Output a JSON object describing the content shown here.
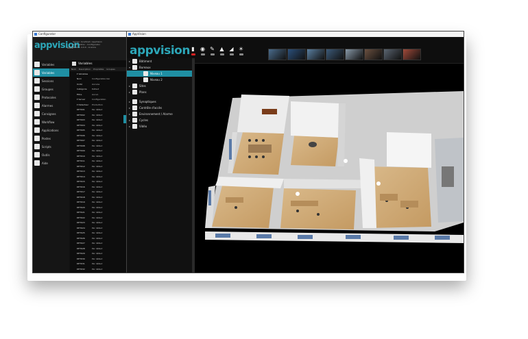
{
  "window1": {
    "title": "Configurator",
    "logo": "appvision",
    "logo_sub": "v4.0",
    "info_lines": [
      "Server: localhost / AppVision",
      "User: admin - Configurator",
      "Version 4.0.0 - Licence"
    ],
    "nav": [
      {
        "label": "Variables",
        "icon": "variables-icon",
        "active": false
      },
      {
        "label": "Variables",
        "icon": "variables-icon",
        "active": true
      },
      {
        "label": "Sessions",
        "icon": "sessions-icon",
        "active": false
      },
      {
        "label": "Groupes",
        "icon": "groups-icon",
        "active": false
      },
      {
        "label": "Protocoles",
        "icon": "protocols-icon",
        "active": false
      },
      {
        "label": "Alarmes",
        "icon": "alarms-icon",
        "active": false
      },
      {
        "label": "Consignes",
        "icon": "instructions-icon",
        "active": false
      },
      {
        "label": "Workflow",
        "icon": "workflow-icon",
        "active": false
      },
      {
        "label": "Applications",
        "icon": "applications-icon",
        "active": false
      },
      {
        "label": "Postes",
        "icon": "stations-icon",
        "active": false
      },
      {
        "label": "Scripts",
        "icon": "scripts-icon",
        "active": false
      },
      {
        "label": "Outils",
        "icon": "tools-icon",
        "active": false
      },
      {
        "label": "Aide",
        "icon": "help-icon",
        "active": false
      }
    ],
    "panel_title": "Variables",
    "tabs": [
      "Nom",
      "Description",
      "Propriétés",
      "Groupes"
    ],
    "rows": [
      {
        "c1": "▾ Variables",
        "c2": ""
      },
      {
        "c1": "Nom",
        "c2": "Configuration.Var"
      },
      {
        "c1": "Unité",
        "c2": "Aucune"
      },
      {
        "c1": "Catégorie",
        "c2": "Défaut"
      },
      {
        "c1": "Filtre",
        "c2": "Aucun"
      },
      {
        "c1": "▾ Server",
        "c2": "Configuration"
      },
      {
        "c1": "▾ Detecteur",
        "c2": "Production"
      },
      {
        "c1": "DET001",
        "c2": "Par défaut"
      },
      {
        "c1": "DET002",
        "c2": "Par défaut"
      },
      {
        "c1": "DET003",
        "c2": "Par défaut"
      },
      {
        "c1": "DET004",
        "c2": "Par défaut"
      },
      {
        "c1": "DET005",
        "c2": "Par défaut"
      },
      {
        "c1": "DET006",
        "c2": "Par défaut"
      },
      {
        "c1": "DET007",
        "c2": "Par défaut"
      },
      {
        "c1": "DET008",
        "c2": "Par défaut"
      },
      {
        "c1": "DET009",
        "c2": "Par défaut"
      },
      {
        "c1": "DET010",
        "c2": "Par défaut"
      },
      {
        "c1": "DET011",
        "c2": "Par défaut"
      },
      {
        "c1": "DET012",
        "c2": "Par défaut"
      },
      {
        "c1": "DET013",
        "c2": "Par défaut"
      },
      {
        "c1": "DET014",
        "c2": "Par défaut"
      },
      {
        "c1": "DET015",
        "c2": "Par défaut"
      },
      {
        "c1": "DET016",
        "c2": "Par défaut"
      },
      {
        "c1": "DET017",
        "c2": "Par défaut"
      },
      {
        "c1": "DET018",
        "c2": "Par défaut"
      },
      {
        "c1": "DET019",
        "c2": "Par défaut"
      },
      {
        "c1": "DET020",
        "c2": "Par défaut"
      },
      {
        "c1": "DET021",
        "c2": "Par défaut"
      },
      {
        "c1": "DET022",
        "c2": "Par défaut"
      },
      {
        "c1": "DET023",
        "c2": "Par défaut"
      },
      {
        "c1": "DET024",
        "c2": "Par défaut"
      },
      {
        "c1": "DET025",
        "c2": "Par défaut"
      },
      {
        "c1": "DET026",
        "c2": "Par défaut"
      },
      {
        "c1": "DET027",
        "c2": "Par défaut"
      },
      {
        "c1": "DET028",
        "c2": "Par défaut"
      },
      {
        "c1": "DET029",
        "c2": "Par défaut"
      },
      {
        "c1": "DET030",
        "c2": "Par défaut"
      },
      {
        "c1": "DET031",
        "c2": "Par défaut"
      },
      {
        "c1": "DET032",
        "c2": "Par défaut"
      },
      {
        "c1": "DET033",
        "c2": "Par défaut"
      }
    ]
  },
  "window2": {
    "title": "AppVision",
    "logo": "appvision",
    "logo_sub": "v4.0",
    "tools": [
      {
        "glyph": "▮",
        "name": "phone-icon",
        "red": true
      },
      {
        "glyph": "◉",
        "name": "clock-icon",
        "red": false
      },
      {
        "glyph": "✎",
        "name": "edit-icon",
        "red": false
      },
      {
        "glyph": "▲",
        "name": "bell-icon",
        "red": false
      },
      {
        "glyph": "◢",
        "name": "camera-icon",
        "red": false
      },
      {
        "glyph": "☀",
        "name": "light-icon",
        "red": false
      }
    ],
    "thumb_colors": [
      "#4a6c8c",
      "#2b4f7a",
      "#5a7fa0",
      "#3c5a78",
      "#8899a8",
      "#6a5040",
      "#5a6470",
      "#a04a3a"
    ],
    "tree": [
      {
        "label": "Bâtiment",
        "level": 0,
        "arrow": "▸",
        "icon": "building-icon",
        "sel": false
      },
      {
        "label": "Bureaux",
        "level": 0,
        "arrow": "▾",
        "icon": "building-icon",
        "sel": false
      },
      {
        "label": "Niveau 1",
        "level": 1,
        "arrow": "",
        "icon": "floor-icon",
        "sel": true
      },
      {
        "label": "Niveau 2",
        "level": 1,
        "arrow": "",
        "icon": "floor-icon",
        "sel": false
      },
      {
        "label": "Sites",
        "level": 0,
        "arrow": "▸",
        "icon": "site-icon",
        "sel": false
      },
      {
        "label": "Plans",
        "level": 0,
        "arrow": "▸",
        "icon": "plan-icon",
        "sel": false
      },
      {
        "gap": true
      },
      {
        "label": "Synoptiques",
        "level": 0,
        "arrow": "▸",
        "icon": "synoptic-icon",
        "sel": false
      },
      {
        "label": "Contrôle d'accès",
        "level": 0,
        "arrow": "▸",
        "icon": "access-icon",
        "sel": false
      },
      {
        "label": "Environnement / Alarme",
        "level": 0,
        "arrow": "▸",
        "icon": "environment-icon",
        "sel": false
      },
      {
        "label": "Cycles",
        "level": 0,
        "arrow": "▸",
        "icon": "cycles-icon",
        "sel": false
      },
      {
        "label": "Vidéo",
        "level": 0,
        "arrow": "▸",
        "icon": "video-icon",
        "sel": false
      }
    ]
  }
}
